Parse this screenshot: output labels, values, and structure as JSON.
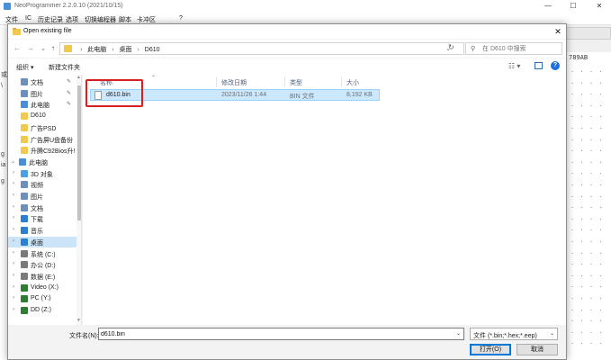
{
  "app": {
    "title": "NeoProgrammer 2.2.0.10 (2021/10/15)",
    "minimize": "—",
    "maximize": "☐",
    "close": "✕",
    "menu": [
      "文件",
      "IC",
      "历史记录",
      "选项",
      "切换编程器",
      "脚本",
      "卡冲区",
      "?"
    ],
    "hex_header": "789AB",
    "left_strip": [
      "或",
      "\\",
      "g",
      "ia",
      "g"
    ]
  },
  "dialog": {
    "title": "Open existing file",
    "close": "✕",
    "nav": {
      "back": "←",
      "forward": "→",
      "recent": "⌄",
      "up": "↑"
    },
    "breadcrumb": [
      "此电脑",
      "桌面",
      "D610"
    ],
    "addr_dropdown": "⌄",
    "refresh": "↻",
    "search_icon": "⚲",
    "search_placeholder": "在 D610 中搜索",
    "toolbar": {
      "organize": "组织 ▾",
      "new_folder": "新建文件夹",
      "view": "☷ ▾",
      "help": "?"
    },
    "nav_pane": [
      {
        "label": "文档",
        "pin": true,
        "color": "#6b8fbf",
        "indent": 1
      },
      {
        "label": "图片",
        "pin": true,
        "color": "#6b8fbf",
        "indent": 1
      },
      {
        "label": "此电脑",
        "pin": true,
        "color": "#4a90d9",
        "indent": 1
      },
      {
        "label": "D610",
        "pin": false,
        "color": "#f2c94c",
        "indent": 1
      },
      {
        "label": "广告PSD",
        "pin": false,
        "color": "#f2c94c",
        "indent": 1
      },
      {
        "label": "广告屏U盘备份",
        "pin": false,
        "color": "#f2c94c",
        "indent": 1
      },
      {
        "label": "升腾C92Bios升!",
        "pin": false,
        "color": "#f2c94c",
        "indent": 1
      },
      {
        "label": "此电脑",
        "pin": false,
        "color": "#4a90d9",
        "indent": 0,
        "chev": true
      },
      {
        "label": "3D 对象",
        "pin": false,
        "color": "#4aa0e0",
        "indent": 1,
        "chev": true
      },
      {
        "label": "视频",
        "pin": false,
        "color": "#6b8fbf",
        "indent": 1,
        "chev": true
      },
      {
        "label": "图片",
        "pin": false,
        "color": "#6b8fbf",
        "indent": 1,
        "chev": true
      },
      {
        "label": "文档",
        "pin": false,
        "color": "#6b8fbf",
        "indent": 1,
        "chev": true
      },
      {
        "label": "下载",
        "pin": false,
        "color": "#2a7fd4",
        "indent": 1,
        "chev": true
      },
      {
        "label": "音乐",
        "pin": false,
        "color": "#2a7fd4",
        "indent": 1,
        "chev": true
      },
      {
        "label": "桌面",
        "pin": false,
        "color": "#2a7fd4",
        "indent": 1,
        "chev": true,
        "selected": true
      },
      {
        "label": "系统 (C:)",
        "pin": false,
        "color": "#7a7a7a",
        "indent": 1,
        "chev": true
      },
      {
        "label": "办公 (D:)",
        "pin": false,
        "color": "#7a7a7a",
        "indent": 1,
        "chev": true
      },
      {
        "label": "数据 (E:)",
        "pin": false,
        "color": "#7a7a7a",
        "indent": 1,
        "chev": true
      },
      {
        "label": "Video (X:)",
        "pin": false,
        "color": "#2e7d32",
        "indent": 1,
        "chev": true
      },
      {
        "label": "PC (Y:)",
        "pin": false,
        "color": "#2e7d32",
        "indent": 1,
        "chev": true
      },
      {
        "label": "DD (Z:)",
        "pin": false,
        "color": "#2e7d32",
        "indent": 1,
        "chev": true
      }
    ],
    "columns": [
      "名称",
      "修改日期",
      "类型",
      "大小"
    ],
    "files": [
      {
        "name": "d610.bin",
        "modified": "2023/11/26 1:44",
        "type": "BIN 文件",
        "size": "8,192 KB"
      }
    ],
    "file_name_label": "文件名(N):",
    "file_name_value": "d610.bin",
    "filter": "文件 (*.bin;*.hex;*.eep)",
    "open_button": "打开(O)",
    "cancel_button": "取消"
  }
}
